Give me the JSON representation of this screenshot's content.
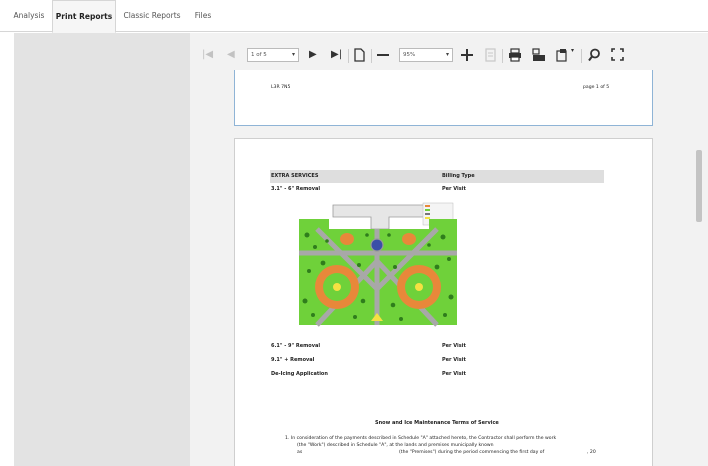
{
  "tabs": [
    {
      "label": "Analysis"
    },
    {
      "label": "Print Reports"
    },
    {
      "label": "Classic Reports"
    },
    {
      "label": "Files"
    }
  ],
  "toolbar": {
    "page_select": "1 of 5",
    "zoom_select": "95%"
  },
  "page1": {
    "left_text": "L3R 7N5",
    "right_text": "page 1 of 5"
  },
  "page2": {
    "header_left": "EXTRA SERVICES",
    "header_right": "Billing Type",
    "rows": [
      {
        "service": "3.1\" - 6\" Removal",
        "billing": "Per Visit"
      },
      {
        "service": "6.1\" - 9\" Removal",
        "billing": "Per Visit"
      },
      {
        "service": "9.1\" + Removal",
        "billing": "Per Visit"
      },
      {
        "service": "De-Icing Application",
        "billing": "Per Visit"
      }
    ],
    "terms_title": "Snow and Ice Maintenance Terms of Service",
    "terms_line1": "1.   In consideration of the payments described in Schedule \"A\" attached hereto, the Contractor shall perform the work",
    "terms_line2": "(the \"Work\") described in Schedule \"A\", at the lands and premises municipally known",
    "terms_line3a": "as",
    "terms_line3b": "(the \"Premises\") during the period commencing the first day of",
    "terms_line3c": ",  20"
  },
  "colors": {
    "accent": "#8fb4d6",
    "panel": "#e3e3e3",
    "viewer_bg": "#f2f2f2",
    "grass": "#6fd13a",
    "orange": "#e8883a"
  }
}
